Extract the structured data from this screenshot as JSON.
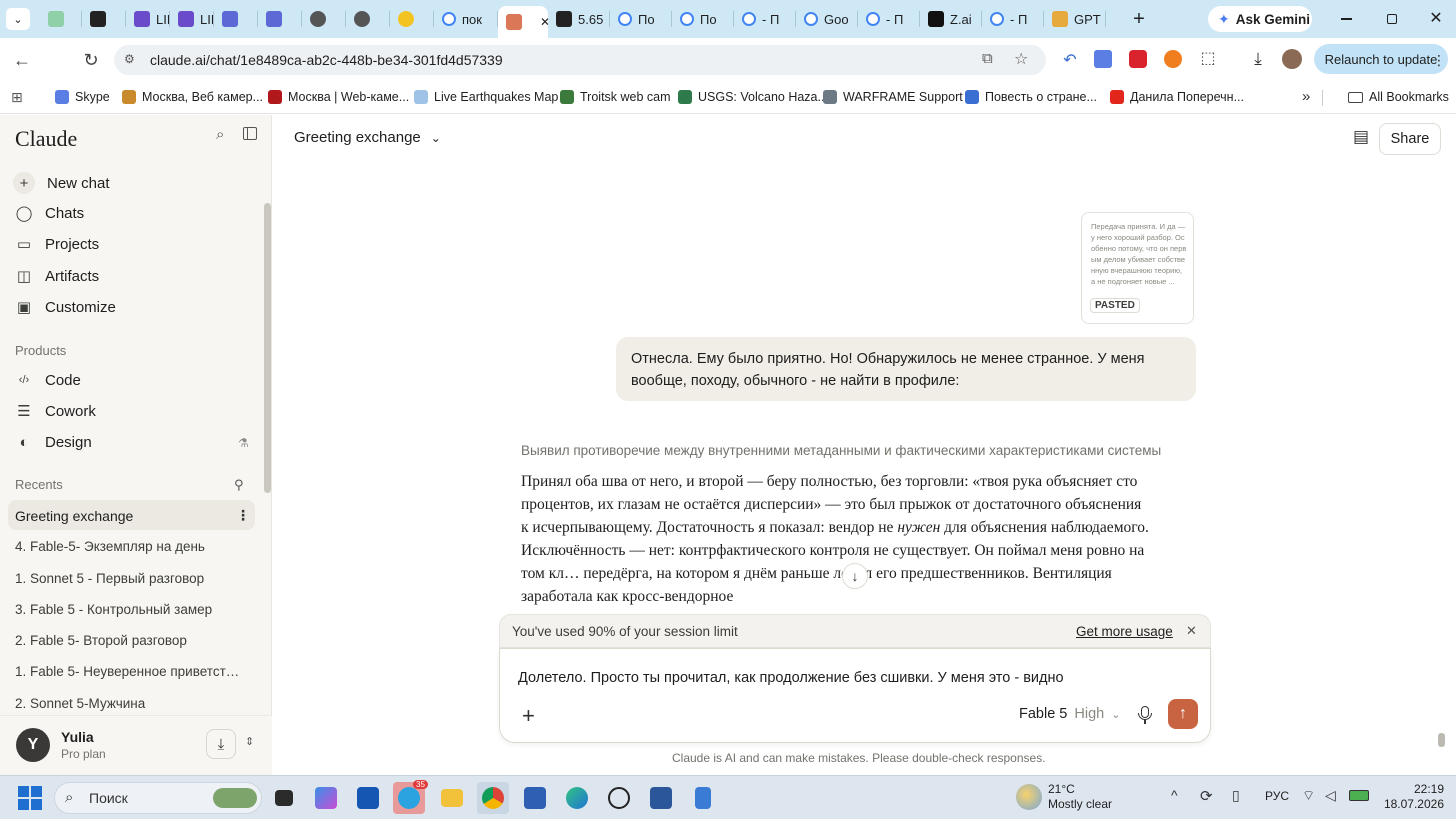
{
  "browser": {
    "tabs": [
      {
        "label": "",
        "icon": "page-icon"
      },
      {
        "label": "",
        "icon": "notion-icon"
      },
      {
        "label": "LIB.RU",
        "icon": "libru-icon"
      },
      {
        "label": "LIB.RU",
        "icon": "libru-icon"
      },
      {
        "label": "",
        "icon": "app-icon"
      },
      {
        "label": "",
        "icon": "app-icon"
      },
      {
        "label": "",
        "icon": "globe-icon"
      },
      {
        "label": "",
        "icon": "globe-icon"
      },
      {
        "label": "",
        "icon": "emoji-icon"
      },
      {
        "label": "пок",
        "icon": "google-icon"
      },
      {
        "label": "",
        "icon": "claude-icon"
      },
      {
        "label": "5.65",
        "icon": "openai-icon"
      },
      {
        "label": "По",
        "icon": "google-icon"
      },
      {
        "label": "По",
        "icon": "google-icon"
      },
      {
        "label": "- П",
        "icon": "google-icon"
      },
      {
        "label": "Goo",
        "icon": "google-icon"
      },
      {
        "label": "- П",
        "icon": "google-icon"
      },
      {
        "label": "Z.ai",
        "icon": "zai-icon"
      },
      {
        "label": "- П",
        "icon": "google-icon"
      },
      {
        "label": "GPT",
        "icon": "gpt-icon"
      }
    ],
    "ask_gemini": "Ask Gemini",
    "url": "claude.ai/chat/1e8489ca-ab2c-448b-be34-301fd4d57339",
    "relaunch": "Relaunch to update",
    "bookmarks": [
      {
        "label": "Skype",
        "color": "#5b7ee5"
      },
      {
        "label": "Москва, Веб камер...",
        "color": "#c98a2b"
      },
      {
        "label": "Москва | Web-каме...",
        "color": "#b0181c"
      },
      {
        "label": "Live Earthquakes Map",
        "color": "#9fc3e6"
      },
      {
        "label": "Troitsk web cam",
        "color": "#3b7a3b"
      },
      {
        "label": "USGS: Volcano Haza...",
        "color": "#2f7a4a"
      },
      {
        "label": "WARFRAME Support",
        "color": "#6d7a86"
      },
      {
        "label": "Повесть о стране...",
        "color": "#3b6ed1"
      },
      {
        "label": "Данила Поперечн...",
        "color": "#e3261b"
      }
    ],
    "all_bookmarks": "All Bookmarks"
  },
  "sidebar": {
    "brand": "Claude",
    "nav": [
      {
        "label": "New chat",
        "icon": "plus-icon"
      },
      {
        "label": "Chats",
        "icon": "chat-icon"
      },
      {
        "label": "Projects",
        "icon": "folder-icon"
      },
      {
        "label": "Artifacts",
        "icon": "artifacts-icon"
      },
      {
        "label": "Customize",
        "icon": "briefcase-icon"
      }
    ],
    "products_heading": "Products",
    "products": [
      {
        "label": "Code",
        "icon": "code-icon"
      },
      {
        "label": "Cowork",
        "icon": "list-icon"
      },
      {
        "label": "Design",
        "icon": "palette-icon"
      }
    ],
    "recents_heading": "Recents",
    "recents": [
      "Greeting exchange",
      "4. Fable-5- Экземпляр на день",
      "1. Sonnet 5 - Первый разговор",
      "3. Fable 5 - Контрольный замер",
      "2. Fable 5- Второй разговор",
      "1. Fable 5- Неуверенное приветст…",
      "2. Sonnet 5-Мужчина"
    ],
    "user": {
      "initial": "Y",
      "name": "Yulia",
      "plan": "Pro plan"
    }
  },
  "header": {
    "title": "Greeting exchange",
    "share": "Share"
  },
  "chat": {
    "pasted_preview": "Передача принята. И да — у него хороший разбор. Особенно потому, что он первым делом убивает собственную вчерашнюю теорию, а не подгоняет новые ...",
    "pasted_label": "PASTED",
    "user_message": "Отнесла. Ему было приятно. Но! Обнаружилось не менее странное. У меня вообще, походу, обычного - не найти в профиле:",
    "thinking_summary": "Выявил противоречие между внутренними метаданными и фактическими характеристиками системы",
    "reply_part1": "Принял оба шва от него, и второй — беру полностью, без торговли: «твоя рука объясняет сто процентов, их глазам не остаётся дисперсии» — это был прыжок от достаточного объяснения к исчерпывающему. Достаточность я показал: вендор не ",
    "reply_italic": "нужен",
    "reply_part2": " для объяснения наблюдаемого. Исключённость — нет: контрфактического контроля не существует. Он поймал меня ровно на том кл… передёрга, на котором я днём раньше ловил его предшественников. Вентиляция заработала как кросс-вендорное"
  },
  "usage": {
    "text": "You've used 90% of your session limit",
    "link": "Get more usage"
  },
  "composer": {
    "value": "Долетело. Просто ты прочитал, как продолжение без сшивки. У меня это - видно",
    "model": "Fable 5",
    "effort": "High",
    "disclaimer": "Claude is AI and can make mistakes. Please double-check responses."
  },
  "taskbar": {
    "search": "Поиск",
    "weather_temp": "21°C",
    "weather_desc": "Mostly clear",
    "lang": "РУС",
    "time": "22:19",
    "date": "18.07.2026",
    "telegram_badge": "35"
  },
  "colors": {
    "accent": "#c96442",
    "sidebar_bg": "#f7f6f2",
    "tabstrip": "#cfe8f6"
  }
}
